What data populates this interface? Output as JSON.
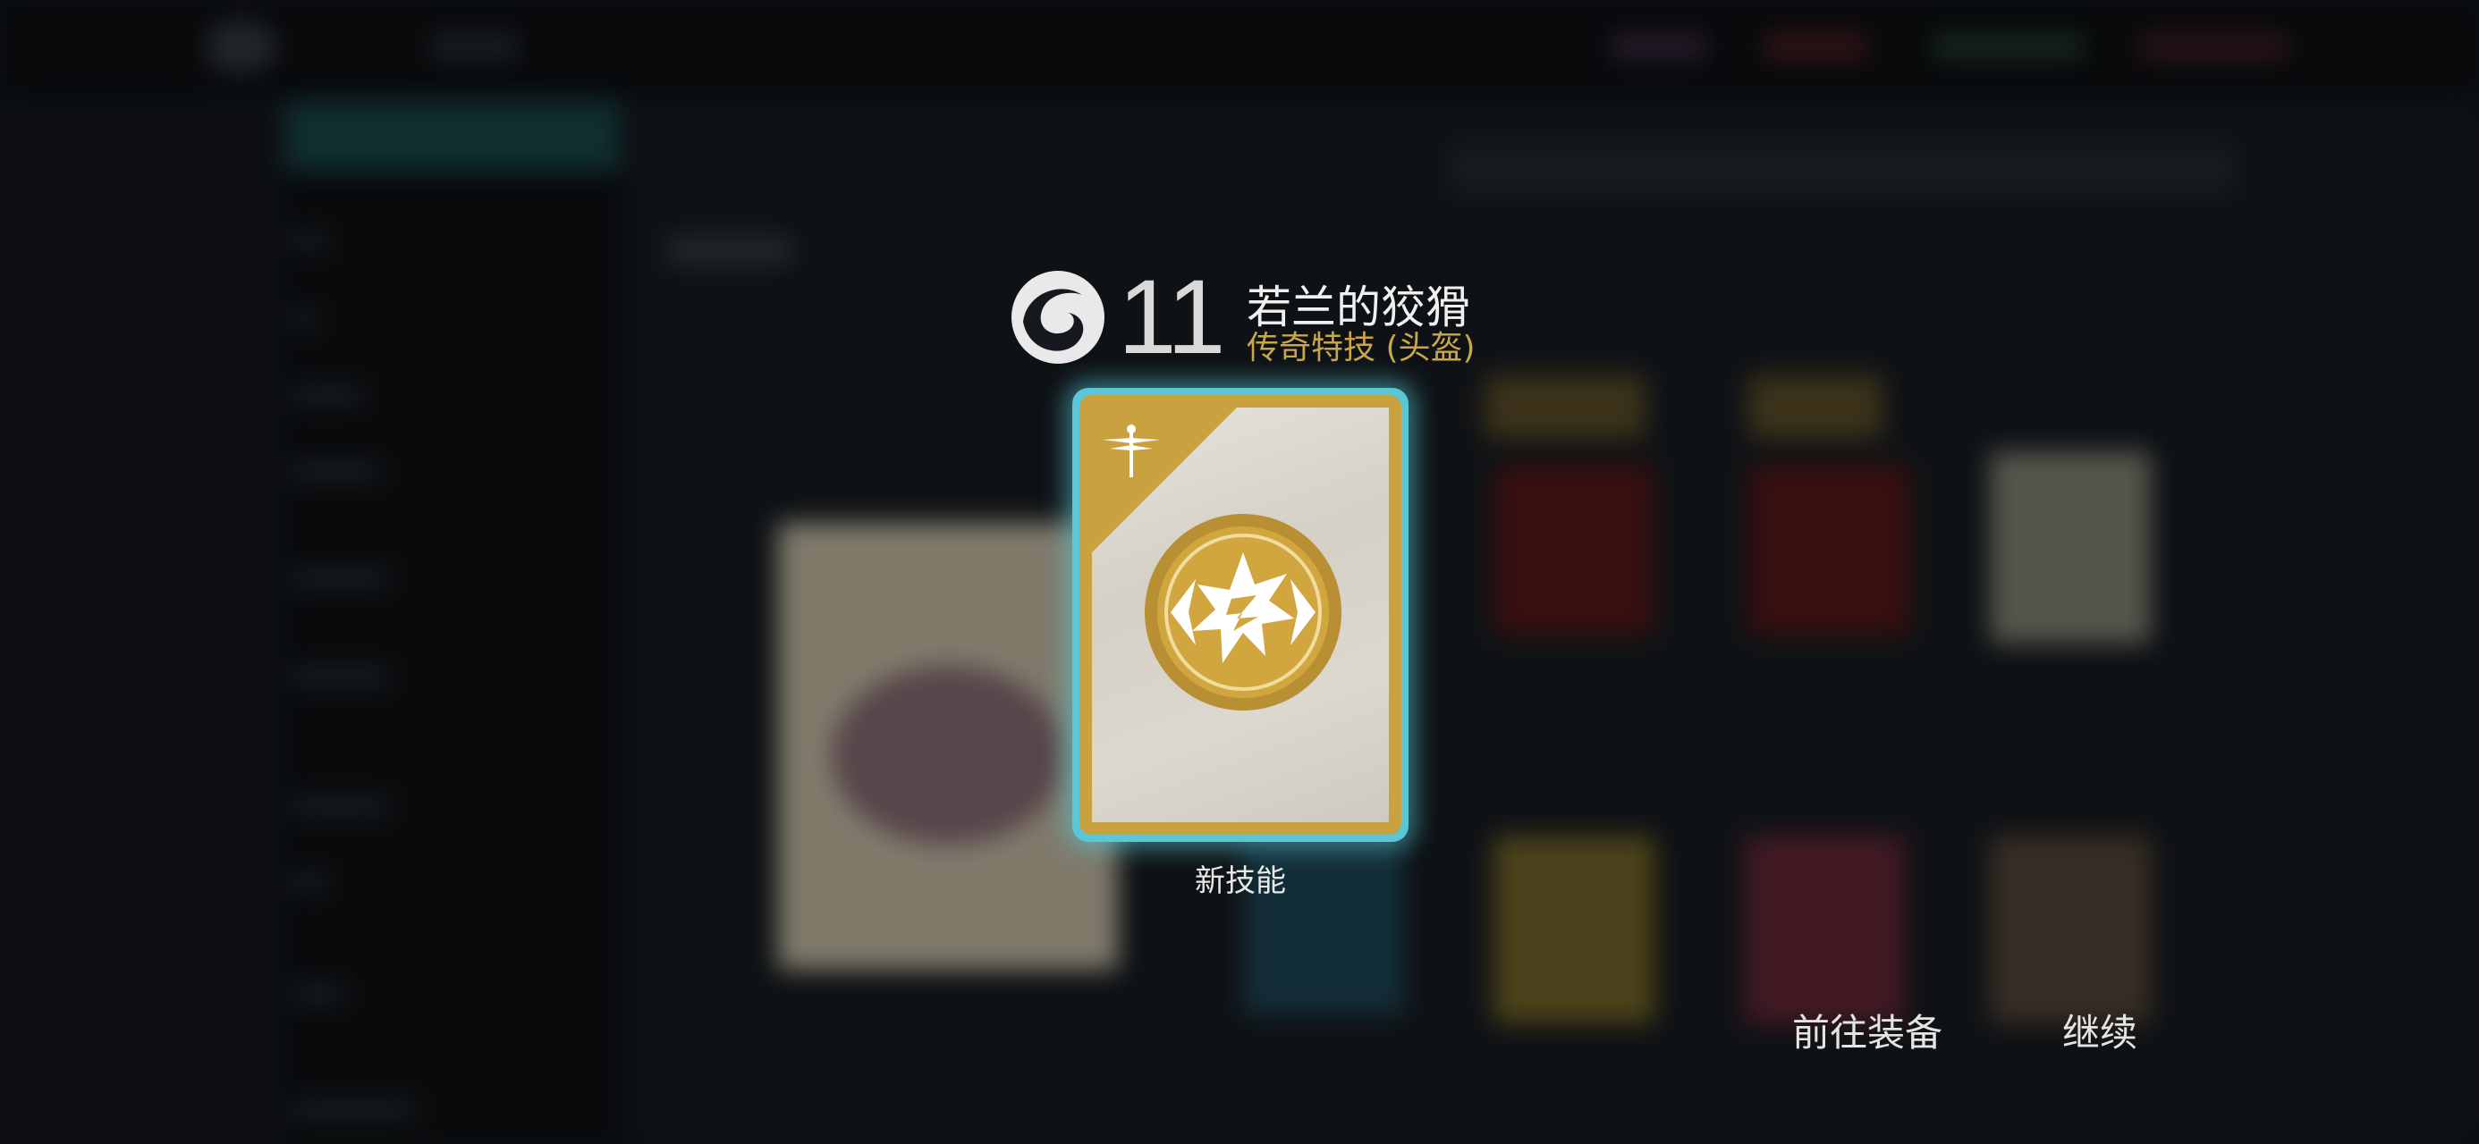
{
  "reward": {
    "level": "11",
    "item_name": "若兰的狡猾",
    "item_type": "传奇特技 (头盔)",
    "card_caption": "新技能",
    "icon": "ghost-swirl-icon",
    "card_icon": "dragonfly-icon",
    "emblem_icon": "skill-burst-emblem-icon"
  },
  "actions": {
    "goto_equipment": "前往装备",
    "continue": "继续"
  },
  "colors": {
    "accent_gold": "#c9a64a",
    "highlight_cyan": "#5bc7d6",
    "card_gold": "#c9a13f"
  }
}
